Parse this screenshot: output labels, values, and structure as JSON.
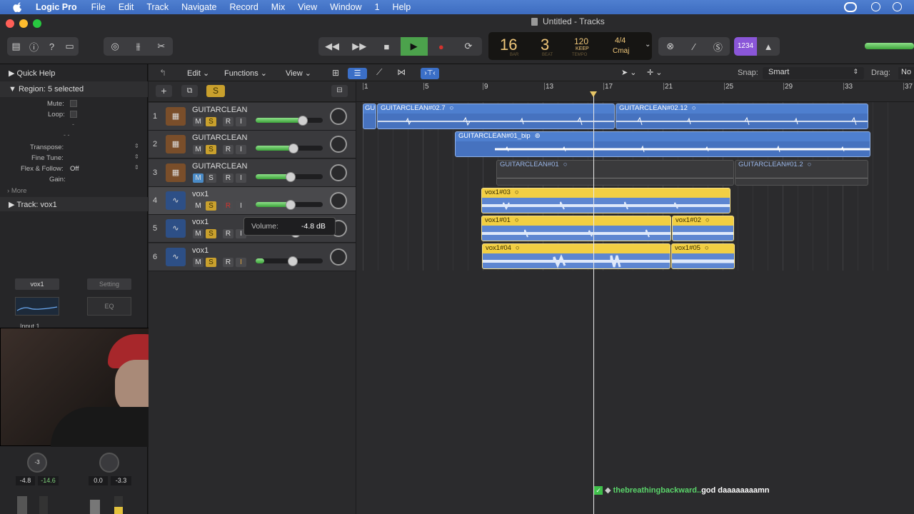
{
  "menubar": {
    "app": "Logic Pro",
    "items": [
      "File",
      "Edit",
      "Track",
      "Navigate",
      "Record",
      "Mix",
      "View",
      "Window",
      "1",
      "Help"
    ]
  },
  "window": {
    "title": "Untitled - Tracks"
  },
  "lcd": {
    "bar": "16",
    "beat": "3",
    "bar_label": "BAR",
    "beat_label": "BEAT",
    "tempo": "120",
    "keep": "KEEP",
    "tempo_label": "TEMPO",
    "signature": "4/4",
    "key": "Cmaj"
  },
  "toolbar": {
    "count_in": "1234"
  },
  "inspector": {
    "quick_help": "Quick Help",
    "region_label": "Region:",
    "region_value": "5 selected",
    "mute": "Mute:",
    "loop": "Loop:",
    "dash1": "-",
    "dash2": "- -",
    "transpose": "Transpose:",
    "fine_tune": "Fine Tune:",
    "flex_follow": "Flex & Follow:",
    "flex_value": "Off",
    "gain": "Gain:",
    "more": "More",
    "track_label": "Track:",
    "track_value": "vox1",
    "channel_name": "vox1",
    "setting": "Setting",
    "eq": "EQ",
    "input": "Input 1",
    "pan_left": "-3",
    "vol_left": "-4.8",
    "peak_left": "-14.6",
    "vol_right": "0.0",
    "peak_right": "-3.3"
  },
  "arrange_bar": {
    "edit": "Edit",
    "functions": "Functions",
    "view": "View",
    "snap_label": "Snap:",
    "snap_value": "Smart",
    "drag_label": "Drag:",
    "drag_value": "No",
    "solo": "S"
  },
  "ruler": [
    "1",
    "5",
    "9",
    "13",
    "17",
    "21",
    "25",
    "29",
    "33",
    "37"
  ],
  "tracks": [
    {
      "num": "1",
      "name": "GUITARCLEAN",
      "m": "M",
      "s": "S",
      "r": "R",
      "i": "I",
      "volume_level": 0.7
    },
    {
      "num": "2",
      "name": "GUITARCLEAN",
      "m": "M",
      "s": "S",
      "r": "R",
      "i": "I",
      "volume_level": 0.56
    },
    {
      "num": "3",
      "name": "GUITARCLEAN",
      "m": "M",
      "s": "S",
      "r": "R",
      "i": "I",
      "volume_level": 0.52
    },
    {
      "num": "4",
      "name": "vox1",
      "m": "M",
      "s": "S",
      "r": "R",
      "i": "I",
      "volume_level": 0.52
    },
    {
      "num": "5",
      "name": "vox1",
      "m": "M",
      "s": "S",
      "r": "R",
      "i": "I",
      "volume_level": 0.6
    },
    {
      "num": "6",
      "name": "vox1",
      "m": "M",
      "s": "S",
      "r": "R",
      "i": "I",
      "volume_level": 0.55
    }
  ],
  "tooltip": {
    "label": "Volume:",
    "value": "-4.8 dB"
  },
  "regions": {
    "r1a": "GU",
    "r1b": "GUITARCLEAN#02.7",
    "r1c": "GUITARCLEAN#02.12",
    "r2a": "GUITARCLEAN#01_bip",
    "r3a": "GUITARCLEAN#01",
    "r3b": "GUITARCLEAN#01.2",
    "r4a": "vox1#03",
    "r5a": "vox1#01",
    "r5b": "vox1#02",
    "r6a": "vox1#04",
    "r6b": "vox1#05"
  },
  "chat": {
    "user": "thebreathingbackward..",
    "message": "god daaaaaaaamn"
  }
}
